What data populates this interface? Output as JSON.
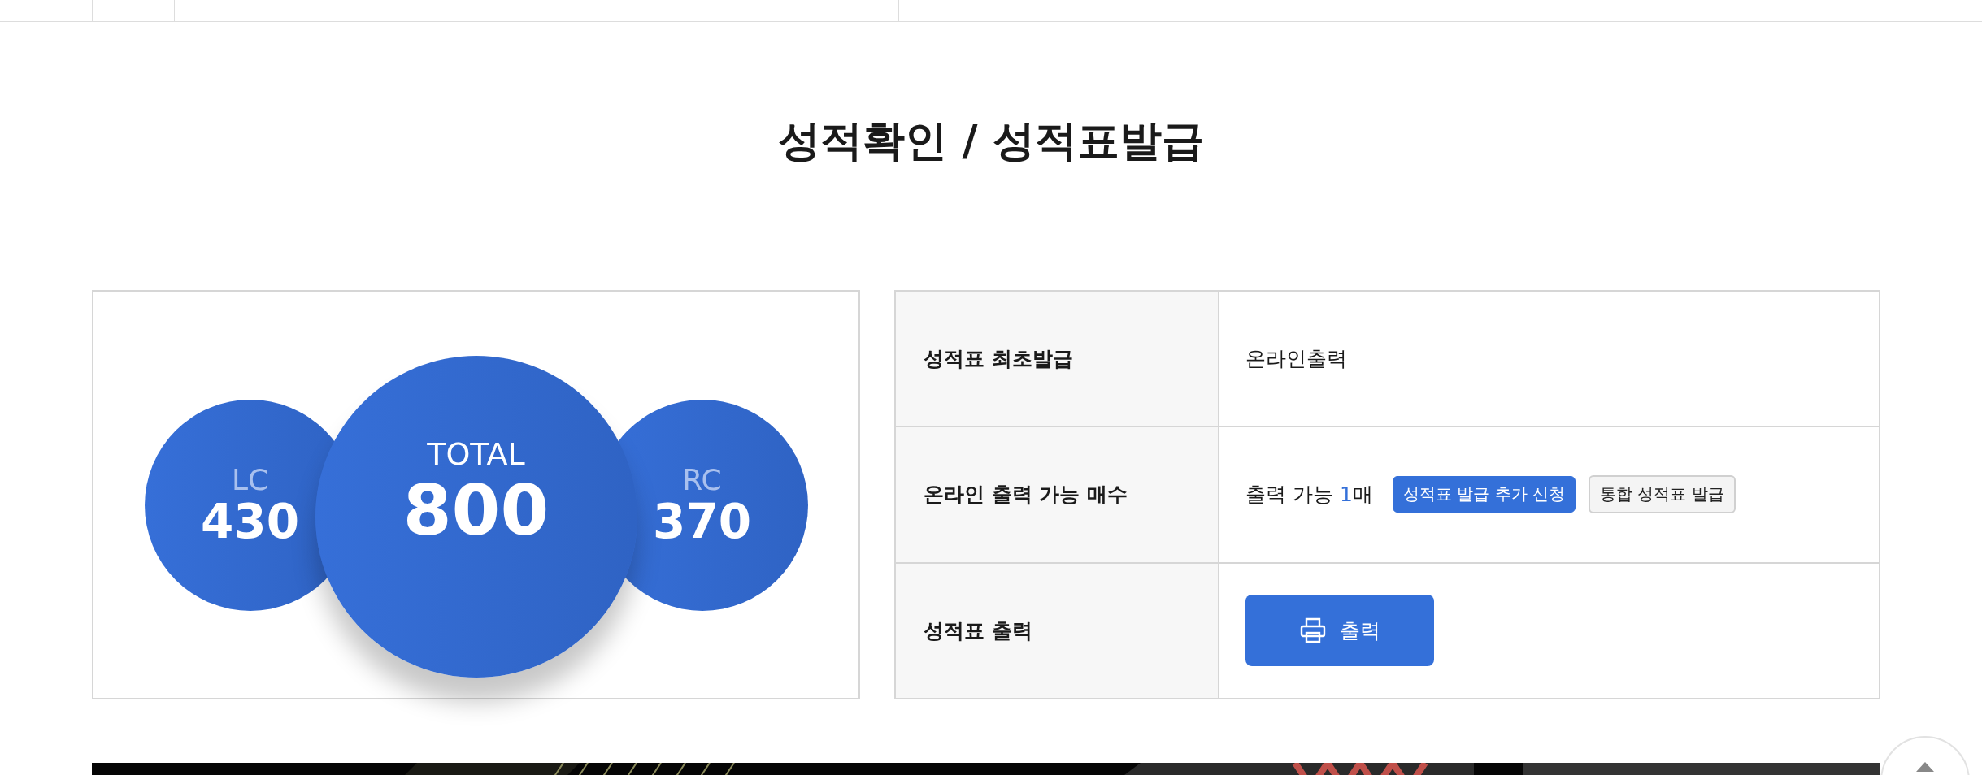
{
  "title": "성적확인 / 성적표발급",
  "scores": [
    {
      "label": "LC",
      "value": "430",
      "kind": "side"
    },
    {
      "label": "TOTAL",
      "value": "800",
      "kind": "main"
    },
    {
      "label": "RC",
      "value": "370",
      "kind": "side"
    }
  ],
  "table": {
    "rows": [
      {
        "kind": "text",
        "label": "성적표 최초발급",
        "value": "온라인출력"
      },
      {
        "kind": "count",
        "label": "온라인 출력 가능 매수",
        "prefix": "출력 가능",
        "count": "1",
        "suffix": "매",
        "buttons": [
          {
            "label": "성적표 발급 추가 신청",
            "primary": true
          },
          {
            "label": "통합 성적표 발급",
            "primary": false
          }
        ]
      },
      {
        "kind": "print",
        "label": "성적표 출력",
        "button": "출력"
      }
    ]
  }
}
